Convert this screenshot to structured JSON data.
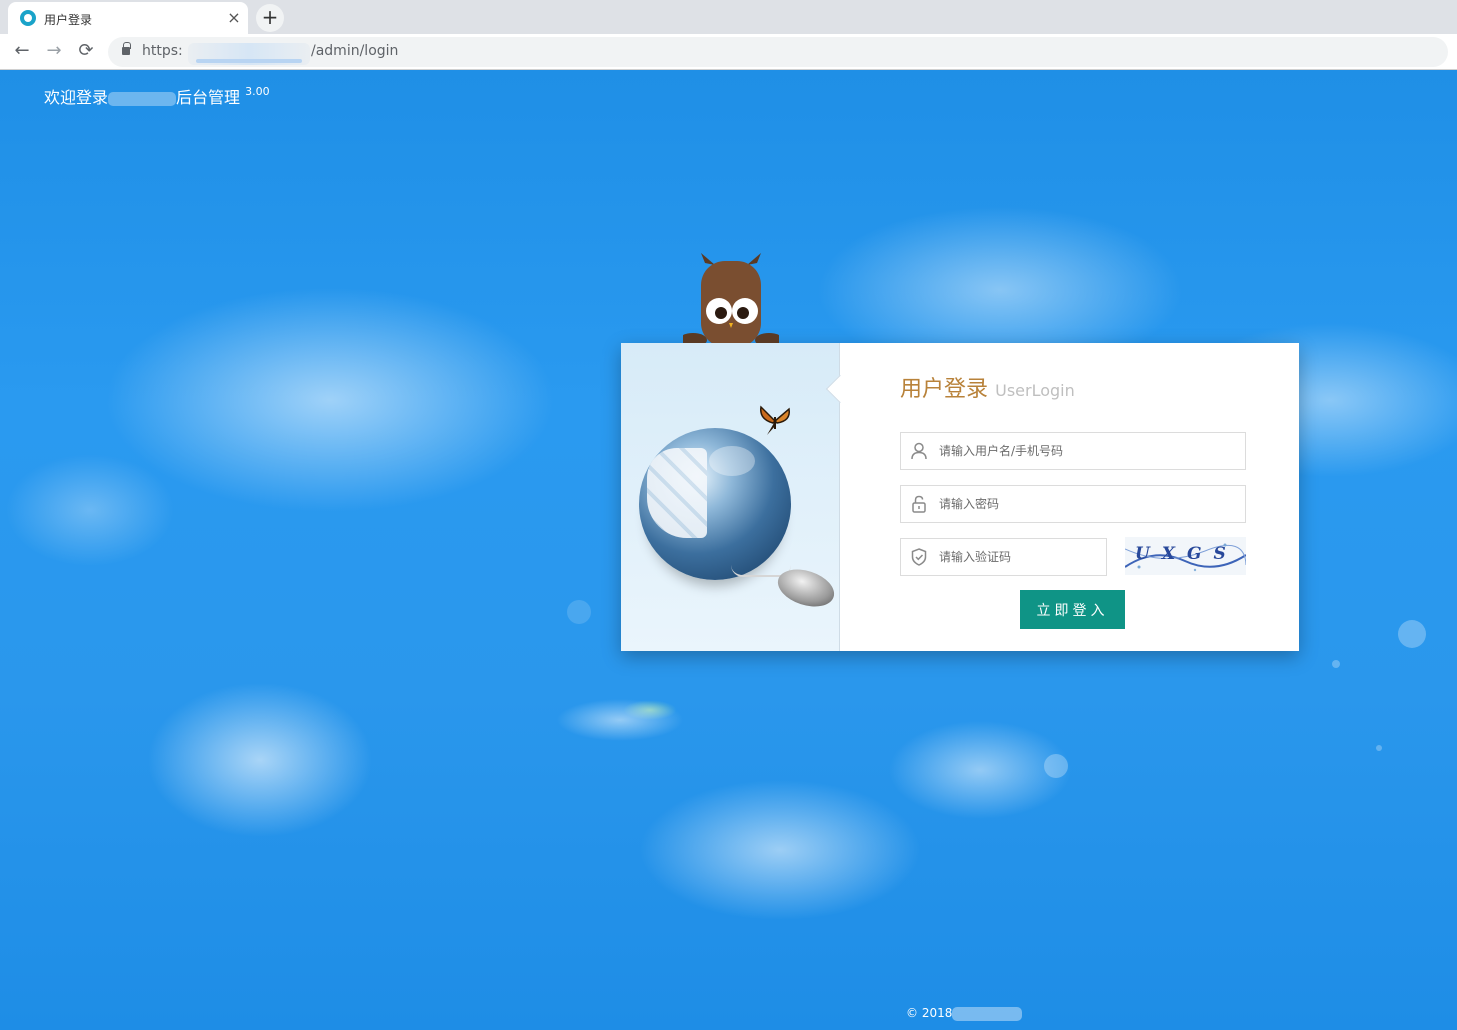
{
  "browser": {
    "tab_title": "用户登录",
    "tab_close": "×",
    "new_tab": "+",
    "nav_back": "←",
    "nav_forward": "→",
    "nav_reload": "⟳",
    "url_scheme": "https:",
    "url_path": "/admin/login"
  },
  "header": {
    "welcome_prefix": "欢迎登录",
    "welcome_suffix": "后台管理",
    "version": "3.00"
  },
  "login": {
    "title": "用户登录",
    "title_en": "UserLogin",
    "username_placeholder": "请输入用户名/手机号码",
    "password_placeholder": "请输入密码",
    "captcha_placeholder": "请输入验证码",
    "captcha_text": "UXGS",
    "submit_label": "立即登入"
  },
  "footer": {
    "copyright": "© 2018"
  },
  "colors": {
    "accent": "#0f9486",
    "title": "#b8823a",
    "background": "#2a9af0"
  },
  "icons": {
    "username": "user-icon",
    "password": "lock-icon",
    "captcha": "shield-icon"
  }
}
